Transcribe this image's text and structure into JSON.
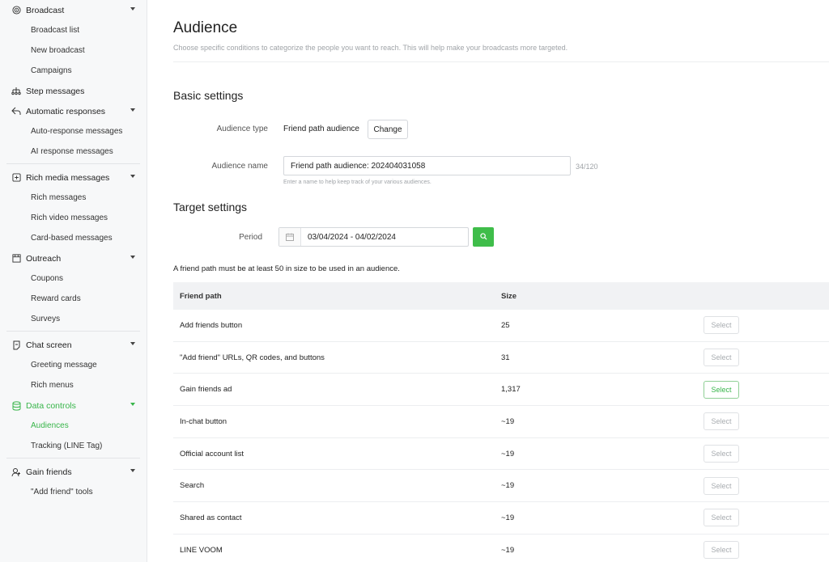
{
  "sidebar": {
    "groups": [
      {
        "label": "Broadcast",
        "icon": "broadcast-icon",
        "items": [
          "Broadcast list",
          "New broadcast",
          "Campaigns"
        ]
      },
      {
        "label": "Step messages",
        "icon": "step-messages-icon"
      },
      {
        "label": "Automatic responses",
        "icon": "automatic-responses-icon",
        "items": [
          "Auto-response messages",
          "AI response messages"
        ]
      },
      {
        "label": "Rich media messages",
        "icon": "rich-media-icon",
        "items": [
          "Rich messages",
          "Rich video messages",
          "Card-based messages"
        ]
      },
      {
        "label": "Outreach",
        "icon": "outreach-icon",
        "items": [
          "Coupons",
          "Reward cards",
          "Surveys"
        ]
      },
      {
        "label": "Chat screen",
        "icon": "chat-screen-icon",
        "items": [
          "Greeting message",
          "Rich menus"
        ]
      },
      {
        "label": "Data controls",
        "icon": "data-controls-icon",
        "items": [
          "Audiences",
          "Tracking (LINE Tag)"
        ]
      },
      {
        "label": "Gain friends",
        "icon": "gain-friends-icon",
        "items": [
          "\"Add friend\" tools"
        ]
      }
    ],
    "accent": "#38b54a"
  },
  "page": {
    "title": "Audience",
    "description": "Choose specific conditions to categorize the people you want to reach. This will help make your broadcasts more targeted."
  },
  "basic": {
    "title": "Basic settings",
    "type_label": "Audience type",
    "type_value": "Friend path audience",
    "change_label": "Change",
    "name_label": "Audience name",
    "name_value": "Friend path audience: 202404031058",
    "name_counter": "34/120",
    "name_hint": "Enter a name to help keep track of your various audiences."
  },
  "target": {
    "title": "Target settings",
    "period_label": "Period",
    "period_value": "03/04/2024 - 04/02/2024",
    "note": "A friend path must be at least 50 in size to be used in an audience."
  },
  "table": {
    "headers": [
      "Friend path",
      "Size"
    ],
    "select_label": "Select",
    "rows": [
      {
        "path": "Add friends button",
        "size": "25"
      },
      {
        "path": "\"Add friend\" URLs, QR codes, and buttons",
        "size": "31"
      },
      {
        "path": "Gain friends ad",
        "size": "1,317"
      },
      {
        "path": "In-chat button",
        "size": "~19"
      },
      {
        "path": "Official account list",
        "size": "~19"
      },
      {
        "path": "Search",
        "size": "~19"
      },
      {
        "path": "Shared as contact",
        "size": "~19"
      },
      {
        "path": "LINE VOOM",
        "size": "~19"
      }
    ]
  }
}
